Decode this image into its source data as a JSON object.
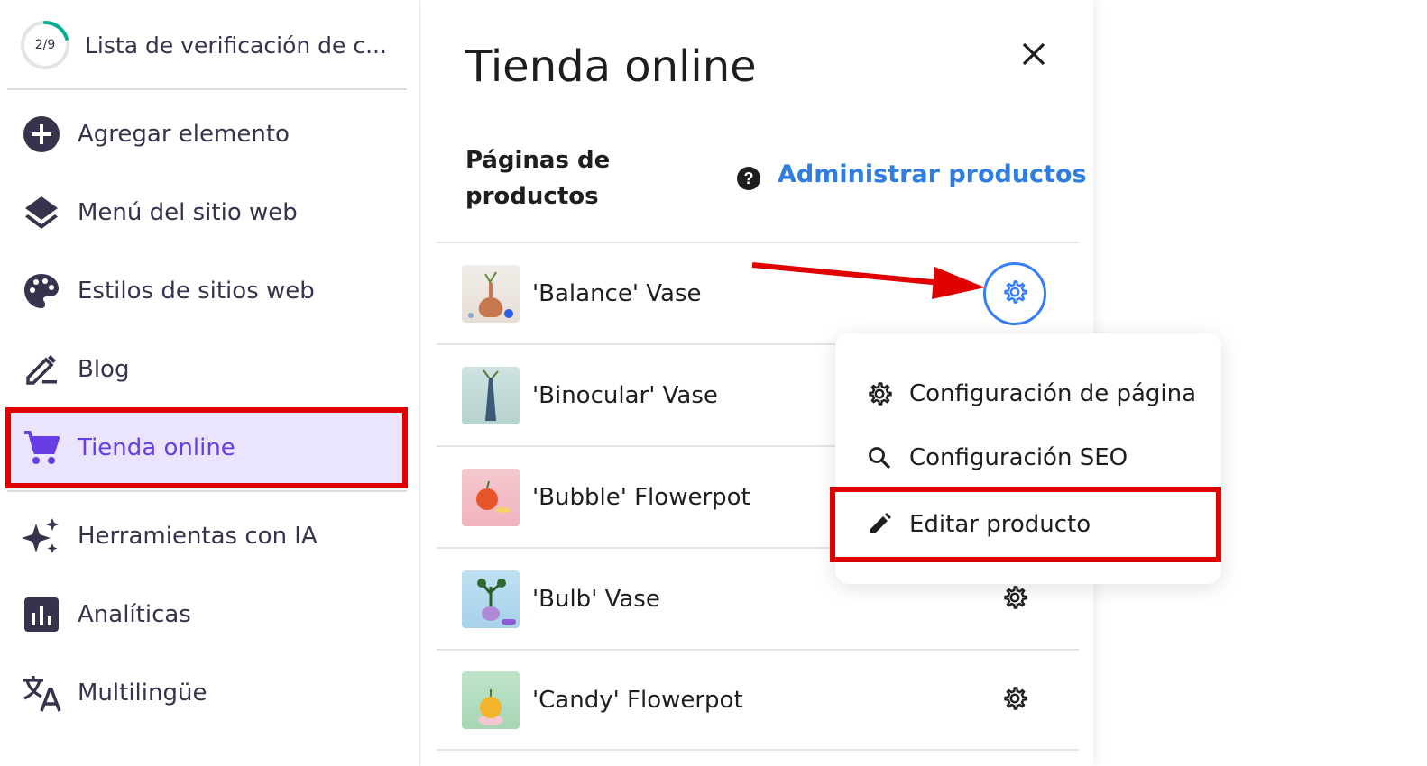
{
  "sidebar": {
    "checklist": {
      "progress": "2/9",
      "progress_fraction": 0.22,
      "label": "Lista de verificación de c..."
    },
    "items": [
      {
        "label": "Agregar elemento",
        "icon": "plus-circle-icon"
      },
      {
        "label": "Menú del sitio web",
        "icon": "layers-icon"
      },
      {
        "label": "Estilos de sitios web",
        "icon": "palette-icon"
      },
      {
        "label": "Blog",
        "icon": "pen-icon"
      },
      {
        "label": "Tienda online",
        "icon": "cart-icon",
        "active": true
      },
      {
        "label": "Herramientas con IA",
        "icon": "sparkles-icon"
      },
      {
        "label": "Analíticas",
        "icon": "bar-chart-icon"
      },
      {
        "label": "Multilingüe",
        "icon": "translate-icon"
      }
    ]
  },
  "panel": {
    "title": "Tienda online",
    "section_label": "Páginas de productos",
    "manage_link": "Administrar productos",
    "products": [
      {
        "name": "'Balance' Vase"
      },
      {
        "name": "'Binocular' Vase"
      },
      {
        "name": "'Bubble' Flowerpot"
      },
      {
        "name": "'Bulb' Vase"
      },
      {
        "name": "'Candy' Flowerpot"
      }
    ]
  },
  "menu": {
    "items": [
      {
        "label": "Configuración de página",
        "icon": "gear-icon"
      },
      {
        "label": "Configuración SEO",
        "icon": "search-icon"
      },
      {
        "label": "Editar producto",
        "icon": "pencil-icon"
      }
    ]
  },
  "colors": {
    "accent": "#673de6",
    "active_bg": "#ebe4ff",
    "link": "#2f7de1",
    "highlight": "#e00000",
    "progress": "#00b090"
  }
}
